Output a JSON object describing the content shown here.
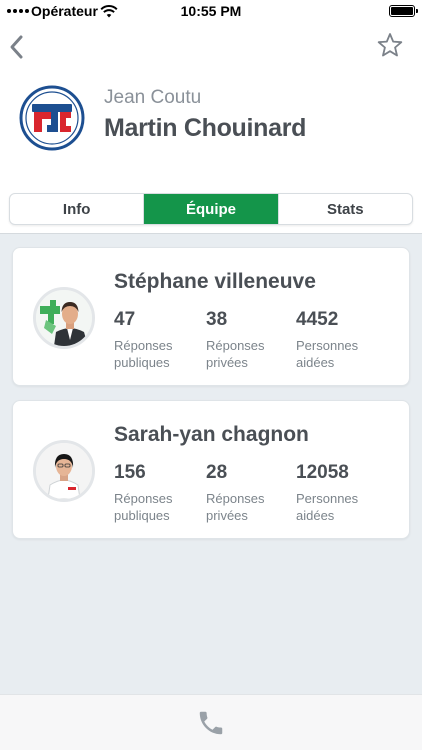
{
  "status_bar": {
    "carrier": "Opérateur",
    "time": "10:55 PM",
    "wifi_icon": "wifi-icon",
    "battery_icon": "battery-full-icon"
  },
  "nav": {
    "back_icon": "chevron-left-icon",
    "favorite_icon": "star-outline-icon"
  },
  "header": {
    "brand": "Jean Coutu",
    "pharmacist_name": "Martin Chouinard",
    "logo_icon": "pjc-logo"
  },
  "tabs": [
    {
      "label": "Info",
      "active": false
    },
    {
      "label": "Équipe",
      "active": true
    },
    {
      "label": "Stats",
      "active": false
    }
  ],
  "team": [
    {
      "name": "Stéphane villeneuve",
      "stats": [
        {
          "value": "47",
          "label_line1": "Réponses",
          "label_line2": "publiques"
        },
        {
          "value": "38",
          "label_line1": "Réponses",
          "label_line2": "privées"
        },
        {
          "value": "4452",
          "label_line1": "Personnes",
          "label_line2": "aidées"
        }
      ]
    },
    {
      "name": "Sarah-yan chagnon",
      "stats": [
        {
          "value": "156",
          "label_line1": "Réponses",
          "label_line2": "publiques"
        },
        {
          "value": "28",
          "label_line1": "Réponses",
          "label_line2": "privées"
        },
        {
          "value": "12058",
          "label_line1": "Personnes",
          "label_line2": "aidées"
        }
      ]
    }
  ],
  "footer": {
    "call_icon": "phone-icon"
  },
  "colors": {
    "accent_green": "#14954a",
    "brand_blue": "#1d4f91",
    "brand_red": "#d9262e",
    "background_gray": "#e8edf1"
  }
}
